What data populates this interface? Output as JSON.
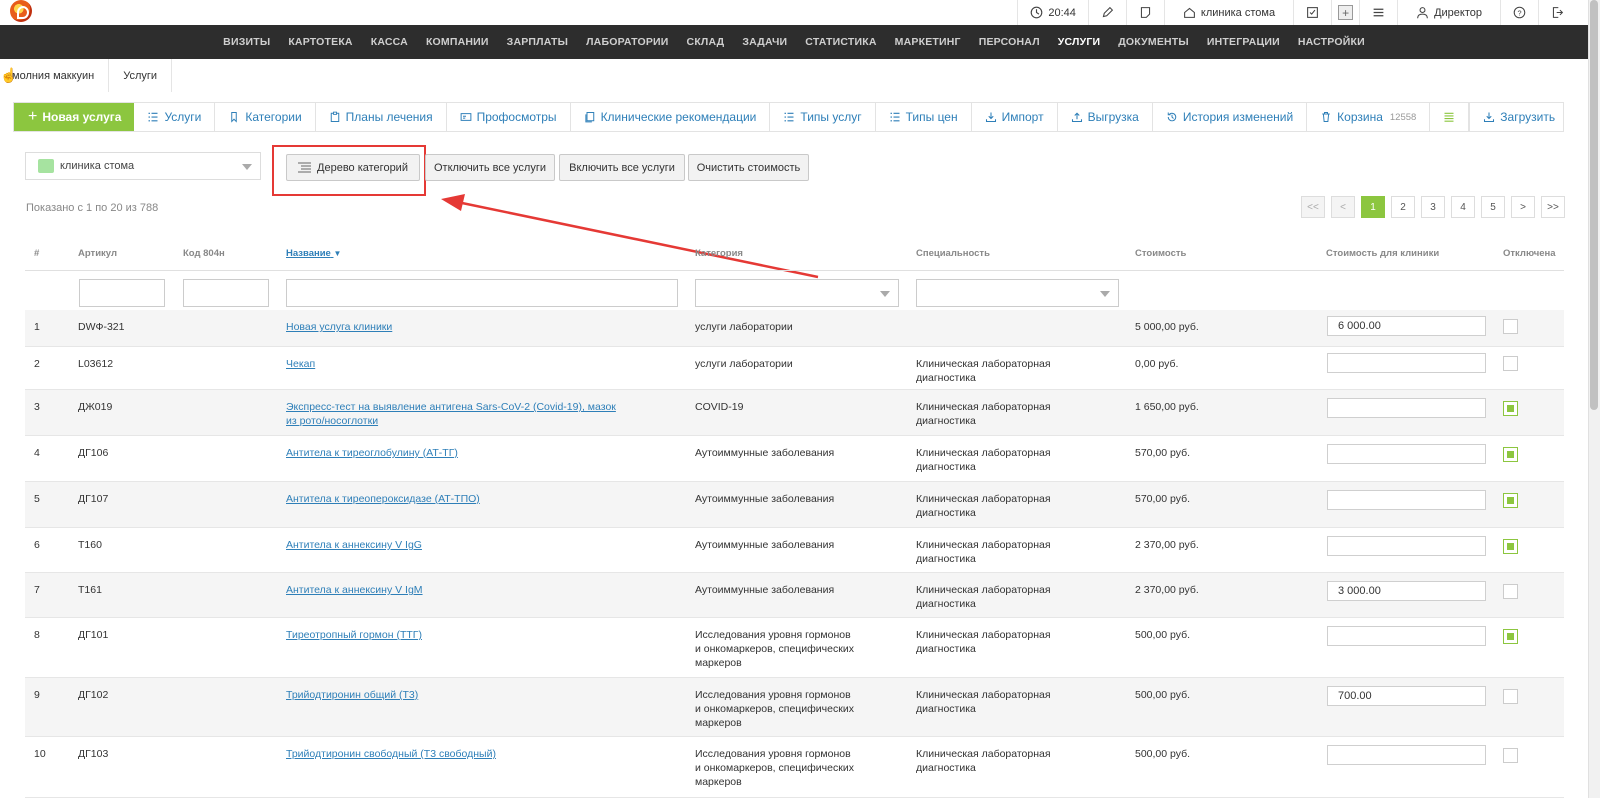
{
  "topbar": {
    "time": "20:44",
    "clinic": "клиника стома",
    "user": "Директор"
  },
  "nav": [
    "ВИЗИТЫ",
    "КАРТОТЕКА",
    "КАССА",
    "КОМПАНИИ",
    "ЗАРПЛАТЫ",
    "ЛАБОРАТОРИИ",
    "СКЛАД",
    "ЗАДАЧИ",
    "СТАТИСТИКА",
    "МАРКЕТИНГ",
    "ПЕРСОНАЛ",
    "УСЛУГИ",
    "ДОКУМЕНТЫ",
    "ИНТЕГРАЦИИ",
    "НАСТРОЙКИ"
  ],
  "nav_active": "УСЛУГИ",
  "breadcrumbs": [
    "молния маккуин",
    "Услуги"
  ],
  "toolbar": {
    "new_service": "Новая услуга",
    "items": [
      "Услуги",
      "Категории",
      "Планы лечения",
      "Профосмотры",
      "Клинические рекомендации",
      "Типы услуг",
      "Типы цен",
      "Импорт",
      "Выгрузка",
      "История изменений",
      "Корзина"
    ],
    "cart_count": "12558",
    "download": "Загрузить"
  },
  "filters": {
    "clinic_select": "клиника стома",
    "tree_button": "Дерево категорий",
    "disable_all": "Отключить все услуги",
    "enable_all": "Включить все услуги",
    "clear_cost": "Очистить стоимость"
  },
  "shown_text": "Показано с 1 по 20 из 788",
  "pager": [
    "<<",
    "<",
    "1",
    "2",
    "3",
    "4",
    "5",
    ">",
    ">>"
  ],
  "pager_active": "1",
  "columns": {
    "num": "#",
    "article": "Артикул",
    "code": "Код 804н",
    "name": "Название",
    "category": "Категория",
    "specialty": "Специальность",
    "cost": "Стоимость",
    "clinic_cost": "Стоимость для клиники",
    "disabled": "Отключена"
  },
  "rows": [
    {
      "n": "1",
      "article": "DWФ-321",
      "name": "Новая услуга клиники",
      "category": "услуги лаборатории",
      "specialty": "",
      "cost": "5 000,00 руб.",
      "clinic_cost": "6 000.00",
      "disabled": false
    },
    {
      "n": "2",
      "article": "L03612",
      "name": "Чекап",
      "category": "услуги лаборатории",
      "specialty": "Клиническая лабораторная диагностика",
      "cost": "0,00 руб.",
      "clinic_cost": "",
      "disabled": false
    },
    {
      "n": "3",
      "article": "ДЖ019",
      "name": "Экспресс-тест на выявление антигена Sars-CoV-2 (Covid-19), мазок из рото/носоглотки",
      "category": "COVID-19",
      "specialty": "Клиническая лабораторная диагностика",
      "cost": "1 650,00 руб.",
      "clinic_cost": "",
      "disabled": true
    },
    {
      "n": "4",
      "article": "ДГ106",
      "name": "Антитела к тиреоглобулину (АТ-ТГ)",
      "category": "Аутоиммунные заболевания",
      "specialty": "Клиническая лабораторная диагностика",
      "cost": "570,00 руб.",
      "clinic_cost": "",
      "disabled": true
    },
    {
      "n": "5",
      "article": "ДГ107",
      "name": "Антитела к тиреопероксидазе (АТ-ТПО)",
      "category": "Аутоиммунные заболевания",
      "specialty": "Клиническая лабораторная диагностика",
      "cost": "570,00 руб.",
      "clinic_cost": "",
      "disabled": true
    },
    {
      "n": "6",
      "article": "Т160",
      "name": "Антитела к аннексину V IgG",
      "category": "Аутоиммунные заболевания",
      "specialty": "Клиническая лабораторная диагностика",
      "cost": "2 370,00 руб.",
      "clinic_cost": "",
      "disabled": true
    },
    {
      "n": "7",
      "article": "Т161",
      "name": "Антитела к аннексину V IgM",
      "category": "Аутоиммунные заболевания",
      "specialty": "Клиническая лабораторная диагностика",
      "cost": "2 370,00 руб.",
      "clinic_cost": "3 000.00",
      "disabled": false
    },
    {
      "n": "8",
      "article": "ДГ101",
      "name": "Тиреотропный гормон (ТТГ)",
      "category": "Исследования уровня гормонов и онкомаркеров, специфических маркеров",
      "specialty": "Клиническая лабораторная диагностика",
      "cost": "500,00 руб.",
      "clinic_cost": "",
      "disabled": true
    },
    {
      "n": "9",
      "article": "ДГ102",
      "name": "Трийодтиронин общий (Т3)",
      "category": "Исследования уровня гормонов и онкомаркеров, специфических маркеров",
      "specialty": "Клиническая лабораторная диагностика",
      "cost": "500,00 руб.",
      "clinic_cost": "700.00",
      "disabled": false
    },
    {
      "n": "10",
      "article": "ДГ103",
      "name": "Трийодтиронин свободный (Т3 свободный)",
      "category": "Исследования уровня гормонов и онкомаркеров, специфических маркеров",
      "specialty": "Клиническая лабораторная диагностика",
      "cost": "500,00 руб.",
      "clinic_cost": "",
      "disabled": false
    }
  ],
  "colors": {
    "accent": "#8cc63f",
    "link": "#2e7fb8",
    "nav_bg": "#2d2d2d",
    "annotation": "#e53935"
  }
}
